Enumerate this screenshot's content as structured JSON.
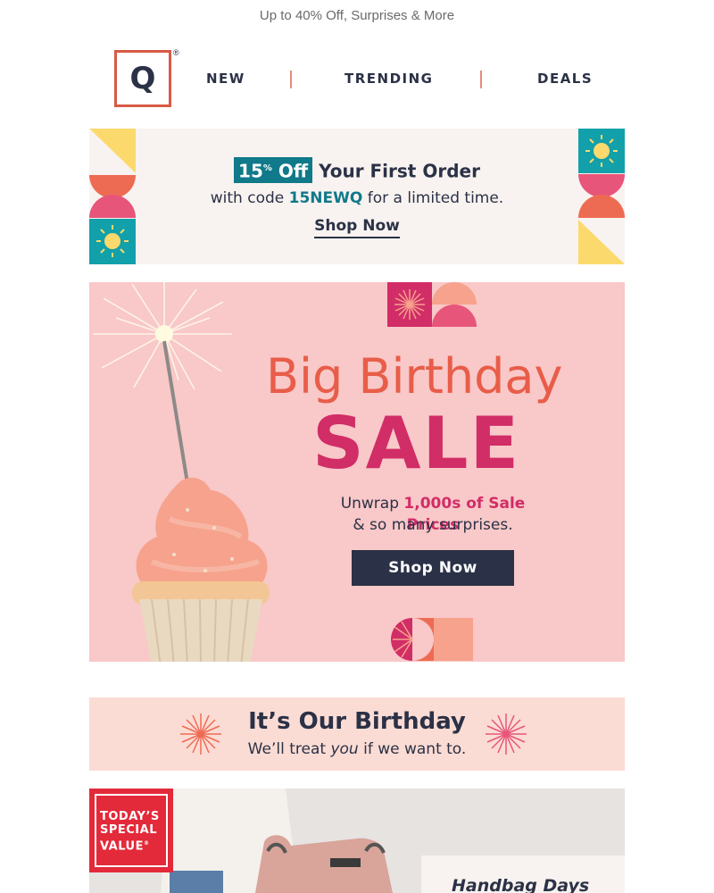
{
  "preheader": {
    "text": "Up to 40% Off, Surprises & More"
  },
  "header": {
    "logo_letter": "Q",
    "registered": "®",
    "nav": [
      {
        "label": "NEW"
      },
      {
        "label": "TRENDING"
      },
      {
        "label": "DEALS"
      }
    ]
  },
  "promo": {
    "badge_number": "15",
    "badge_percent": "%",
    "badge_off": "Off",
    "line1_rest": "Your First Order",
    "line2_before": "with code",
    "code": "15NEWQ",
    "line2_after": "for a limited time.",
    "cta": "Shop Now"
  },
  "hero": {
    "title_line1": "Big Birthday",
    "title_line2": "SALE",
    "sub_prefix": "Unwrap",
    "sub_highlight": "1,000s of Sale Prices",
    "sub_line2": "& so many surprises.",
    "cta": "Shop Now"
  },
  "birthday_banner": {
    "title": "It’s Our Birthday",
    "sub_before": "We’ll treat",
    "sub_em": "you",
    "sub_after": "if we want to."
  },
  "special_value": {
    "badge_lines": [
      "TODAY’S",
      "SPECIAL",
      "VALUE"
    ],
    "badge_mark": "®",
    "card_title": "Handbag Days"
  },
  "colors": {
    "navy": "#2b3146",
    "teal": "#10798a",
    "coral": "#e85d49",
    "magenta": "#d12d67",
    "hero_bg": "#f9c8c8",
    "banner_bg": "#fbdcd4",
    "tsv_red": "#e32a3a"
  }
}
